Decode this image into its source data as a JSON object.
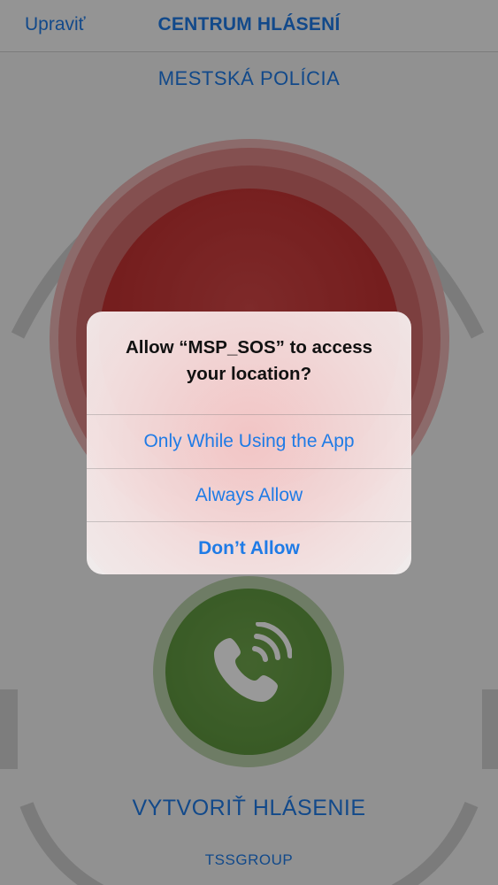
{
  "navbar": {
    "edit_label": "Upraviť",
    "title": "CENTRUM HLÁSENÍ"
  },
  "main": {
    "subtitle": "MESTSKÁ POLÍCIA",
    "sos_button_icon": "sos-icon",
    "call_button_icon": "phone-icon",
    "create_report_label": "VYTVORIŤ HLÁSENIE",
    "footer_brand": "TSSGROUP"
  },
  "alert": {
    "title": "Allow “MSP_SOS” to access your location?",
    "options": [
      {
        "label": "Only While Using the App"
      },
      {
        "label": "Always Allow"
      },
      {
        "label": "Don’t Allow"
      }
    ]
  },
  "colors": {
    "accent": "#1f7be6",
    "sos_red": "#c33232",
    "call_green": "#5f973f",
    "nav_background": "#f7f7f7"
  }
}
